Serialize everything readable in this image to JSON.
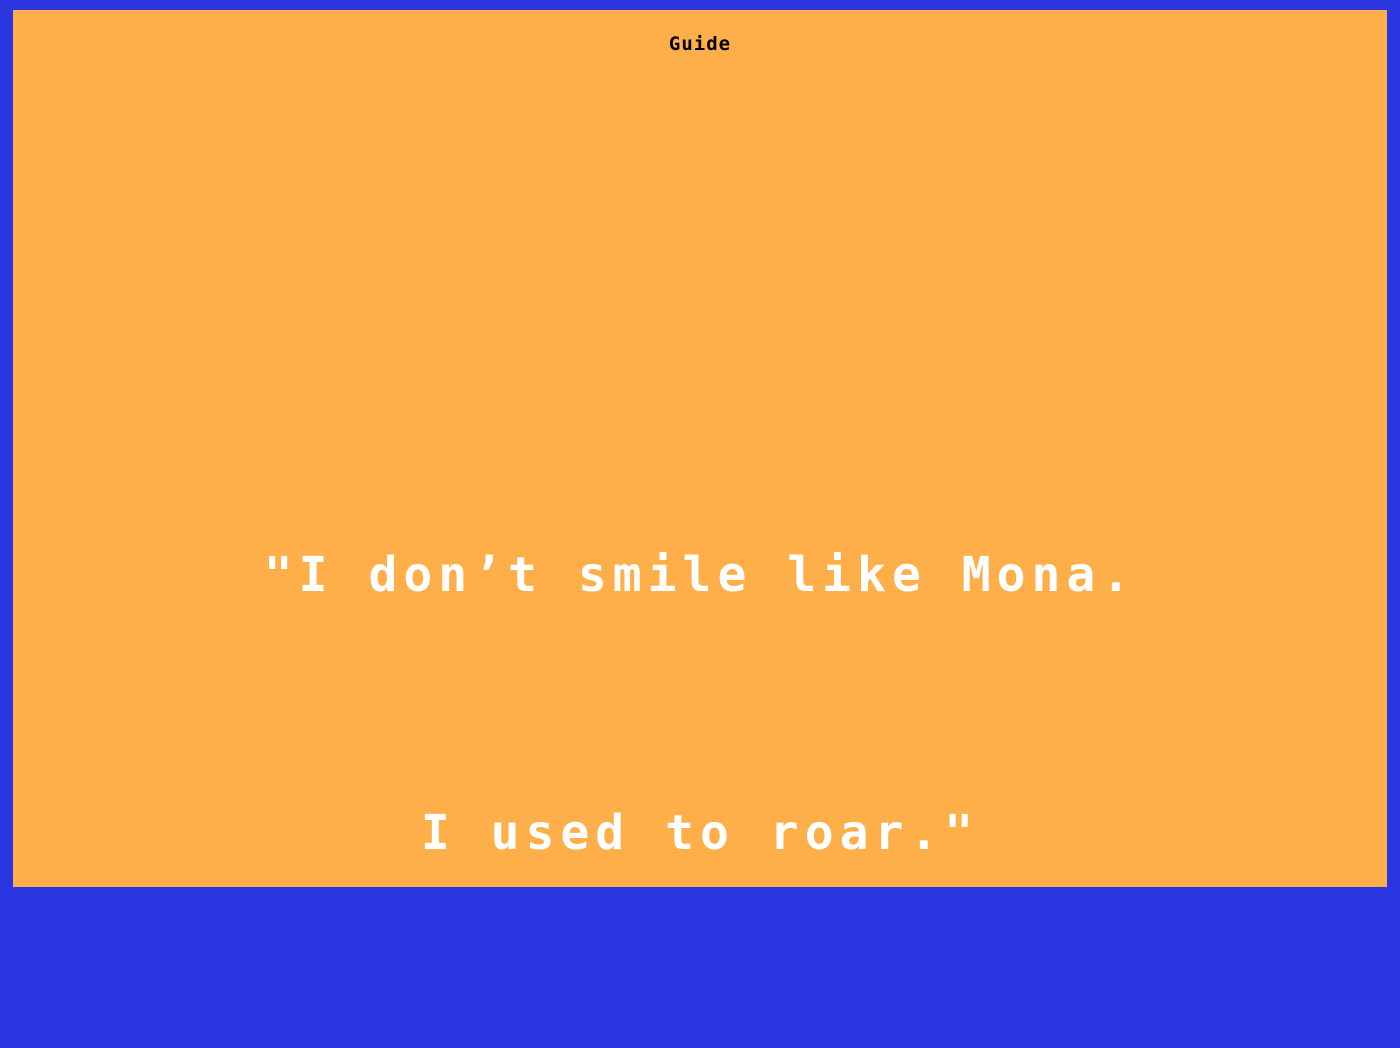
{
  "colors": {
    "border": "#2b35e0",
    "background": "#feaf4a",
    "title_text": "#000000",
    "quote_text": "#ffffff"
  },
  "screen": {
    "title": "Guide",
    "dialogue": {
      "lines": [
        "\"I don’t smile like Mona.",
        "I used to roar.\""
      ]
    }
  }
}
